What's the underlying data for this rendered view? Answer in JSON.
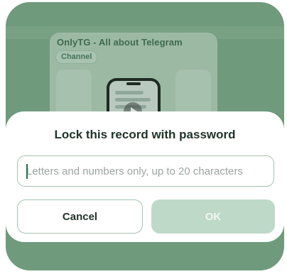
{
  "background_card": {
    "title": "OnlyTG - All about Telegram",
    "badge": "Channel"
  },
  "dialog": {
    "title": "Lock this record with password",
    "password_input": {
      "value": "",
      "placeholder": "Letters and numbers only, up to 20 characters"
    },
    "cancel_label": "Cancel",
    "ok_label": "OK"
  },
  "colors": {
    "accent": "#2d6f4a",
    "ok_disabled": "#bfd9c9",
    "overlay": "#6f9a7c",
    "border": "#a7c2b0"
  }
}
